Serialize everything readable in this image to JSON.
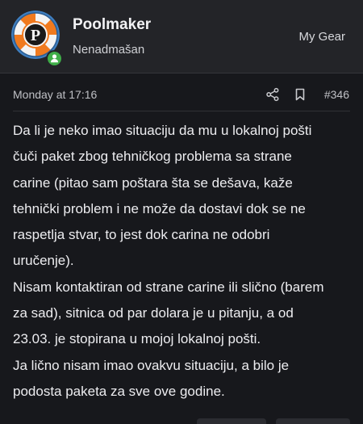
{
  "header": {
    "username": "Poolmaker",
    "user_title": "Nenadmašan",
    "gear_link": "My Gear",
    "avatar_letter": "P"
  },
  "post": {
    "date": "Monday at 17:16",
    "number": "#346",
    "lines": [
      "Da li je neko imao situaciju da mu u lokalnoj pošti",
      "čuči paket zbog tehničkog problema sa strane",
      "carine (pitao sam poštara šta se dešava, kaže",
      "tehnički problem i ne može da dostavi dok se ne",
      "raspetlja stvar, to jest dok carina ne odobri",
      "uručenje).",
      "Nisam kontaktiran od strane carine ili slično (barem",
      "za sad), sitnica od par dolara je u pitanju, a od",
      "23.03. je stopirana u mojoj lokalnoj pošti.",
      "Ja lično nisam imao ovakvu situaciju, a bilo je",
      "podosta paketa za sve ove godine."
    ]
  },
  "icons": {
    "share": "share-icon",
    "bookmark": "bookmark-icon",
    "online": "online-status-icon"
  },
  "colors": {
    "background": "#17181c",
    "header_bg": "#232428",
    "online_green": "#3fae48",
    "avatar_orange": "#f07a1e",
    "avatar_blue": "#3f7fc0"
  }
}
